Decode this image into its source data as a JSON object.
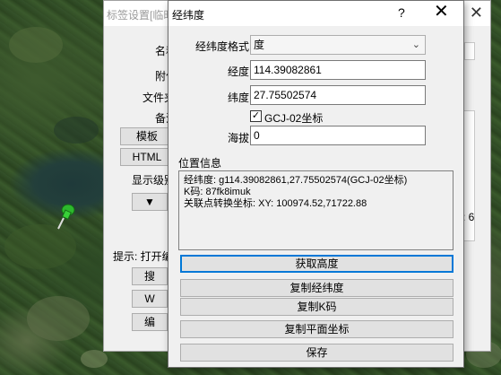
{
  "background_window": {
    "title": "标签设置[临时",
    "labels": [
      "名称",
      "附件",
      "文件夹",
      "备注"
    ],
    "buttons": [
      "模板",
      "HTML",
      "搜",
      "W",
      "编"
    ],
    "display_level": "显示级别",
    "hint": "提示: 打开编",
    "right_number": ": 6",
    "close_glyph": "✕"
  },
  "dialog": {
    "title": "经纬度",
    "help_glyph": "?",
    "close_glyph": "✕",
    "format_label": "经纬度格式",
    "format_value": "度",
    "longitude_label": "经度",
    "longitude_value": "114.39082861",
    "latitude_label": "纬度",
    "latitude_value": "27.75502574",
    "gcj_checkbox_label": "GCJ-02坐标",
    "gcj_checked": true,
    "altitude_label": "海拔",
    "altitude_value": "0",
    "position_group_title": "位置信息",
    "info_lines": [
      "经纬度: g114.39082861,27.75502574(GCJ-02坐标)",
      "K码: 87fk8imuk",
      "关联点转换坐标: XY: 100974.52,71722.88"
    ],
    "buttons": {
      "get_altitude": "获取高度",
      "copy_latlon": "复制经纬度",
      "copy_kcode": "复制K码",
      "copy_plane": "复制平面坐标",
      "save": "保存"
    }
  },
  "icons": {
    "pushpin": "pushpin-icon",
    "dropdown": "chevron-down-icon",
    "check": "checkmark-icon"
  },
  "colors": {
    "focus_border": "#0078d7",
    "pin_green": "#2db82d"
  }
}
